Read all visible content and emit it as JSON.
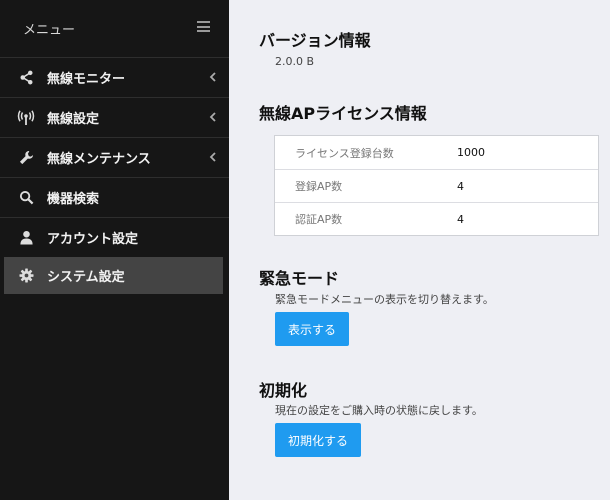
{
  "sidebar": {
    "title": "メニュー",
    "items": [
      {
        "label": "無線モニター",
        "icon": "share-icon",
        "expandable": true
      },
      {
        "label": "無線設定",
        "icon": "antenna-icon",
        "expandable": true
      },
      {
        "label": "無線メンテナンス",
        "icon": "wrench-icon",
        "expandable": true
      },
      {
        "label": "機器検索",
        "icon": "search-icon",
        "expandable": false
      },
      {
        "label": "アカウント設定",
        "icon": "user-icon",
        "expandable": false
      },
      {
        "label": "システム設定",
        "icon": "gear-icon",
        "expandable": false,
        "active": true
      }
    ]
  },
  "main": {
    "version": {
      "heading": "バージョン情報",
      "value": "2.0.0 B"
    },
    "license": {
      "heading": "無線APライセンス情報",
      "rows": [
        {
          "key": "ライセンス登録台数",
          "value": "1000"
        },
        {
          "key": "登録AP数",
          "value": "4"
        },
        {
          "key": "認証AP数",
          "value": "4"
        }
      ]
    },
    "emergency": {
      "heading": "緊急モード",
      "description": "緊急モードメニューの表示を切り替えます。",
      "button": "表示する"
    },
    "reset": {
      "heading": "初期化",
      "description": "現在の設定をご購入時の状態に戻します。",
      "button": "初期化する"
    }
  },
  "colors": {
    "sidebar_bg": "#161616",
    "active_bg": "#444444",
    "accent": "#1f9bf0",
    "main_bg": "#eeeff4"
  }
}
